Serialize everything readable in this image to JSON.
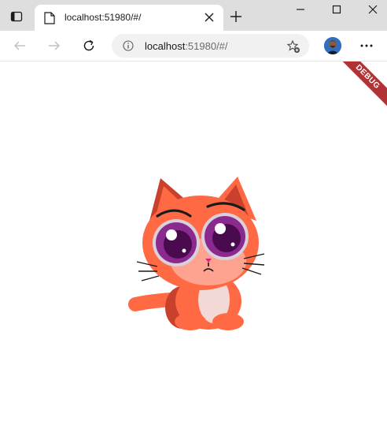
{
  "browser": {
    "tab": {
      "title": "localhost:51980/#/",
      "favicon": "document-icon"
    },
    "address_bar": {
      "host": "localhost",
      "rest": ":51980/#/"
    },
    "controls": [
      "back-icon",
      "forward-icon",
      "reload-icon",
      "info-icon",
      "favorite-star-icon",
      "profile-avatar",
      "more-icon"
    ],
    "window_controls": [
      "minimize-icon",
      "maximize-icon",
      "close-icon"
    ],
    "colors": {
      "titlebar": "#dedede",
      "tab": "#ffffff",
      "addressbar": "#f1f1f1"
    }
  },
  "page": {
    "debug_banner": "DEBUG",
    "illustration": "orange-kitten",
    "colors": {
      "debug_banner": "#b03236",
      "cat_body": "#ff6a45",
      "cat_eyes": "#6b1a6f"
    }
  }
}
